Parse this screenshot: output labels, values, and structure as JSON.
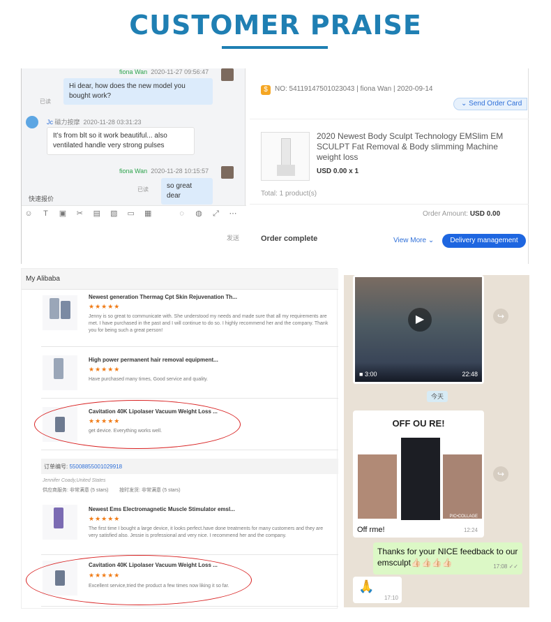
{
  "header": {
    "title": "CUSTOMER PRAISE"
  },
  "chat": {
    "messages": [
      {
        "name": "fiona Wan",
        "time": "2020-11-27 09:56:47",
        "text": "Hi dear, how does the new model you bought work?",
        "status": "已读"
      },
      {
        "name": "Jc",
        "name_suffix": "磁力按摩",
        "time": "2020-11-28 03:31:23",
        "text": "It’s from blt so it work beautiful... also ventilated handle very strong pulses"
      },
      {
        "name": "fiona Wan",
        "time": "2020-11-28 10:15:57",
        "text": "so great dear",
        "status": "已读"
      }
    ],
    "quick_reply": "快速报价",
    "send": "发送",
    "toolbar_icons": [
      "emoji-icon",
      "text-icon",
      "image-icon",
      "scissors-icon",
      "table-icon",
      "doc-icon",
      "folder-icon",
      "grid-icon",
      "chat-icon",
      "user-icon",
      "expand-icon",
      "more-icon"
    ]
  },
  "order": {
    "number_line": "NO: 54119147501023043 | fiona Wan | 2020-09-14",
    "send_card": "Send Order Card",
    "product_title": "2020 Newest Body Sculpt Technology EMSlim EM SCULPT Fat Removal & Body slimming Machine weight loss",
    "price": "USD 0.00 x 1",
    "total": "Total:  1 product(s)",
    "amount_label": "Order Amount:",
    "amount_value": "USD 0.00",
    "status": "Order complete",
    "view_more": "View More",
    "delivery": "Delivery management"
  },
  "reviews": {
    "header": "My Alibaba",
    "items": [
      {
        "title": "Newest generation Thermag Cpt Skin Rejuvenation Th...",
        "stars": "★★★★★",
        "text": "Jenny is so great to communicate with. She understood my needs and made sure that all my requirements are met. I have purchased in the past and I will continue to do so. I highly recommend her and the company. Thank you for being such a great person!"
      },
      {
        "title": "High power permanent hair removal equipment...",
        "stars": "★★★★★",
        "text": "Have purchased many times, Good service and quality."
      },
      {
        "title": "Cavitation 40K Lipolaser Vacuum Weight Loss ...",
        "stars": "★★★★★",
        "text": "get device. Everything works well."
      },
      {
        "title": "Newest Ems Electromagnetic Muscle Stimulator emsl...",
        "stars": "★★★★★",
        "text": "The first time I bought a large device, it looks perfect.have done treatments for many customers and they are very satisfied also. Jessie is professional and very nice. I recommend her and the company."
      },
      {
        "title": "Cavitation 40K Lipolaser Vacuum Weight Loss ...",
        "stars": "★★★★★",
        "text": "Excellent service,tried the product a few times now liking it so far."
      }
    ],
    "order_label": "订单编号:",
    "order_number": "55008855001029918",
    "buyer": "Jennifer Coady,United States",
    "service_label": "供应商服务: 非常满意",
    "service_stars": "(5 stars)",
    "delivery_label": "按时发货: 非常满意",
    "delivery_stars": "(5 stars)"
  },
  "whatsapp": {
    "video_duration": "3:00",
    "video_time": "22:48",
    "date_divider": "今天",
    "image_banner": "OFF  OU  RE!",
    "image_caption": "Off  rme!",
    "image_time": "12:24",
    "collage_label": "PIC•COLLAGE",
    "reply_text": "Thanks for your NICE feedback to our emsculpt👍🏻👍🏻👍🏻👍🏻",
    "reply_time": "17:08 ✓✓",
    "last_time": "17:10"
  }
}
